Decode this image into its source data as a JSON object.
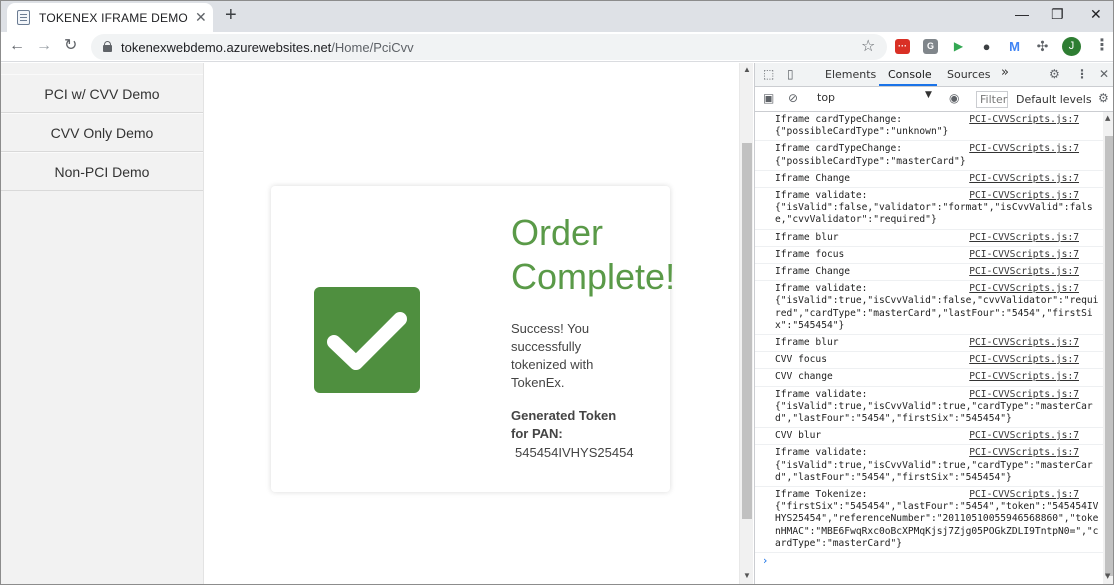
{
  "browser": {
    "tab_title": "TOKENEX IFRAME DEMO",
    "tab_close": "✕",
    "new_tab": "+",
    "win_minimize": "—",
    "win_restore": "❐",
    "win_close": "✕",
    "back": "←",
    "forward": "→",
    "reload": "↻",
    "url_host": "tokenexwebdemo.azurewebsites.net",
    "url_path": "/Home/PciCvv",
    "star": "☆",
    "profile_initial": "J",
    "menu": "⋮",
    "extensions": [
      {
        "label": "···",
        "color": "#d93025"
      },
      {
        "label": "G",
        "color": "#80868b"
      },
      {
        "label": "▶",
        "color": "#34a853"
      },
      {
        "label": "●",
        "color": "#3c4043"
      },
      {
        "label": "M",
        "color": "#4285f4"
      }
    ],
    "puzzle": "✣"
  },
  "sidebar": {
    "items": [
      {
        "label": "PCI w/ CVV Demo"
      },
      {
        "label": "CVV Only Demo"
      },
      {
        "label": "Non-PCI Demo"
      }
    ]
  },
  "order": {
    "title": "Order Complete!",
    "success": "Success! You successfully tokenized with TokenEx.",
    "token_label": "Generated Token for PAN:",
    "token_value": "545454IVHYS25454"
  },
  "devtools": {
    "tabs": [
      "Elements",
      "Console",
      "Sources"
    ],
    "active_tab": "Console",
    "more": "»",
    "context": "top",
    "filter_placeholder": "Filter",
    "levels": "Default levels",
    "prompt": "›",
    "logs": [
      {
        "msg": "Iframe cardTypeChange:\n{\"possibleCardType\":\"unknown\"}",
        "src": "PCI-CVVScripts.js:7"
      },
      {
        "msg": "Iframe cardTypeChange:\n{\"possibleCardType\":\"masterCard\"}",
        "src": "PCI-CVVScripts.js:7"
      },
      {
        "msg": "Iframe Change",
        "src": "PCI-CVVScripts.js:7"
      },
      {
        "msg": "Iframe validate:\n{\"isValid\":false,\"validator\":\"format\",\"isCvvValid\":false,\"cvvValidator\":\"required\"}",
        "src": "PCI-CVVScripts.js:7"
      },
      {
        "msg": "Iframe blur",
        "src": "PCI-CVVScripts.js:7"
      },
      {
        "msg": "Iframe focus",
        "src": "PCI-CVVScripts.js:7"
      },
      {
        "msg": "Iframe Change",
        "src": "PCI-CVVScripts.js:7"
      },
      {
        "msg": "Iframe validate:\n{\"isValid\":true,\"isCvvValid\":false,\"cvvValidator\":\"required\",\"cardType\":\"masterCard\",\"lastFour\":\"5454\",\"firstSix\":\"545454\"}",
        "src": "PCI-CVVScripts.js:7"
      },
      {
        "msg": "Iframe blur",
        "src": "PCI-CVVScripts.js:7"
      },
      {
        "msg": "CVV focus",
        "src": "PCI-CVVScripts.js:7"
      },
      {
        "msg": "CVV change",
        "src": "PCI-CVVScripts.js:7"
      },
      {
        "msg": "Iframe validate:\n{\"isValid\":true,\"isCvvValid\":true,\"cardType\":\"masterCard\",\"lastFour\":\"5454\",\"firstSix\":\"545454\"}",
        "src": "PCI-CVVScripts.js:7"
      },
      {
        "msg": "CVV blur",
        "src": "PCI-CVVScripts.js:7"
      },
      {
        "msg": "Iframe validate:\n{\"isValid\":true,\"isCvvValid\":true,\"cardType\":\"masterCard\",\"lastFour\":\"5454\",\"firstSix\":\"545454\"}",
        "src": "PCI-CVVScripts.js:7"
      },
      {
        "msg": "Iframe Tokenize:\n{\"firstSix\":\"545454\",\"lastFour\":\"5454\",\"token\":\"545454IVHYS25454\",\"referenceNumber\":\"20110510055946568860\",\"tokenHMAC\":\"MBE6FwqRxc0oBcXPMqKjsj7Zjg05POGkZDLI9TntpN0=\",\"cardType\":\"masterCard\"}",
        "src": "PCI-CVVScripts.js:7"
      }
    ]
  },
  "colors": {
    "accent_green": "#5a9a48",
    "check_green": "#4f8f3f",
    "devtools_active": "#1a73e8"
  }
}
